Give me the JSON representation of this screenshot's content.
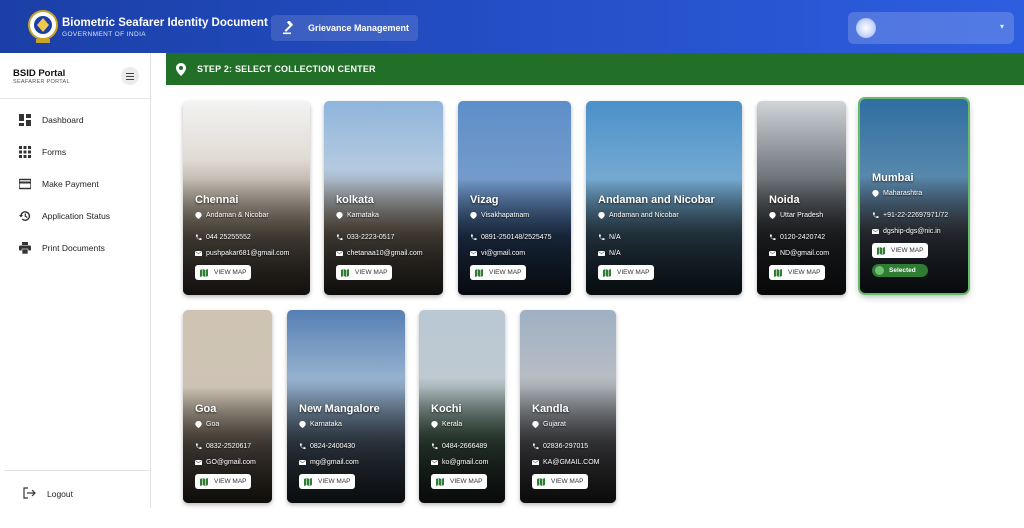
{
  "header": {
    "title": "Biometric Seafarer Identity Document",
    "subtitle": "GOVERNMENT OF INDIA",
    "grievance_label": "Grievance Management",
    "emblem_icon": "emblem-logo",
    "grievance_icon": "gavel-icon",
    "user_icon": "user-avatar",
    "user_caret_icon": "chevron-down-icon",
    "color": "#2450c8"
  },
  "sidebar": {
    "title": "BSID Portal",
    "subtitle": "SEAFARER PORTAL",
    "items": [
      {
        "label": "Dashboard",
        "icon": "dashboard-icon"
      },
      {
        "label": "Forms",
        "icon": "grid-icon"
      },
      {
        "label": "Make Payment",
        "icon": "card-icon"
      },
      {
        "label": "Application Status",
        "icon": "history-icon"
      },
      {
        "label": "Print Documents",
        "icon": "printer-icon"
      }
    ],
    "logout_label": "Logout",
    "logout_icon": "logout-icon"
  },
  "step": {
    "label": "STEP 2: SELECT COLLECTION CENTER",
    "icon": "location-pin-icon",
    "color": "#226f27"
  },
  "centers": [
    {
      "name": "Chennai",
      "location": "Andaman & Nicobar",
      "phone": "044 25255552",
      "email": "pushpakar681@gmail.com",
      "view_map": "VIEW MAP",
      "selected": false
    },
    {
      "name": "kolkata",
      "location": "Karnataka",
      "phone": "033-2223-0517",
      "email": "chetanaa10@gmail.com",
      "view_map": "VIEW MAP",
      "selected": false
    },
    {
      "name": "Vizag",
      "location": "Visakhapatnam",
      "phone": "0891-250148/2525475",
      "email": "vi@gmail.com",
      "view_map": "VIEW MAP",
      "selected": false
    },
    {
      "name": "Andaman and Nicobar",
      "location": "Andaman and Nicobar",
      "phone": "N/A",
      "email": "N/A",
      "view_map": "VIEW MAP",
      "selected": false
    },
    {
      "name": "Noida",
      "location": "Uttar Pradesh",
      "phone": "0120-2420742",
      "email": "ND@gmail.com",
      "view_map": "VIEW MAP",
      "selected": false
    },
    {
      "name": "Mumbai",
      "location": "Maharashtra",
      "phone": "+91-22-22697971/72",
      "email": "dgship-dgs@nic.in",
      "view_map": "VIEW MAP",
      "selected": true,
      "selected_label": "Selected"
    },
    {
      "name": "Goa",
      "location": "Goa",
      "phone": "0832-2520617",
      "email": "GO@gmail.com",
      "view_map": "VIEW MAP",
      "selected": false
    },
    {
      "name": "New Mangalore",
      "location": "Karnataka",
      "phone": "0824-2400430",
      "email": "mg@gmail.com",
      "view_map": "VIEW MAP",
      "selected": false
    },
    {
      "name": "Kochi",
      "location": "Kerala",
      "phone": "0484-2666489",
      "email": "ko@gmail.com",
      "view_map": "VIEW MAP",
      "selected": false
    },
    {
      "name": "Kandla",
      "location": "Gujarat",
      "phone": "02836-297015",
      "email": "KA@GMAIL.COM",
      "view_map": "VIEW MAP",
      "selected": false
    }
  ]
}
